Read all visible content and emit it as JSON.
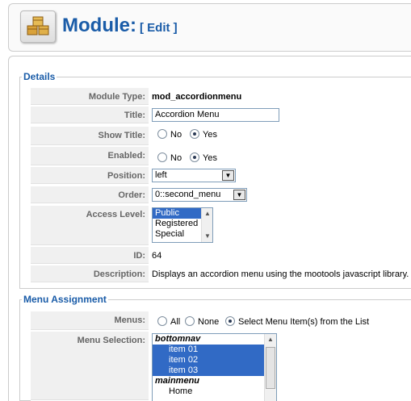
{
  "header": {
    "title": "Module:",
    "subtitle": "[ Edit ]",
    "icon": "modules-boxes-icon"
  },
  "details": {
    "legend": "Details",
    "module_type": {
      "label": "Module Type:",
      "value": "mod_accordionmenu"
    },
    "title": {
      "label": "Title:",
      "value": "Accordion Menu"
    },
    "show_title": {
      "label": "Show Title:",
      "options": [
        "No",
        "Yes"
      ],
      "selected": "Yes"
    },
    "enabled": {
      "label": "Enabled:",
      "options": [
        "No",
        "Yes"
      ],
      "selected": "Yes"
    },
    "position": {
      "label": "Position:",
      "value": "left"
    },
    "order": {
      "label": "Order:",
      "value": "0::second_menu"
    },
    "access_level": {
      "label": "Access Level:",
      "options": [
        "Public",
        "Registered",
        "Special"
      ],
      "selected": "Public"
    },
    "id": {
      "label": "ID:",
      "value": "64"
    },
    "description": {
      "label": "Description:",
      "value": "Displays an accordion menu using the mootools javascript library."
    }
  },
  "menu_assignment": {
    "legend": "Menu Assignment",
    "menus": {
      "label": "Menus:",
      "options": [
        "All",
        "None",
        "Select Menu Item(s) from the List"
      ],
      "selected": "Select Menu Item(s) from the List"
    },
    "menu_selection": {
      "label": "Menu Selection:",
      "items": [
        {
          "text": "bottomnav",
          "group": true,
          "selected": false
        },
        {
          "text": "item 01",
          "group": false,
          "selected": true
        },
        {
          "text": "item 02",
          "group": false,
          "selected": true
        },
        {
          "text": "item 03",
          "group": false,
          "selected": true
        },
        {
          "text": "mainmenu",
          "group": true,
          "selected": false
        },
        {
          "text": "Home",
          "group": false,
          "selected": false
        }
      ]
    }
  }
}
